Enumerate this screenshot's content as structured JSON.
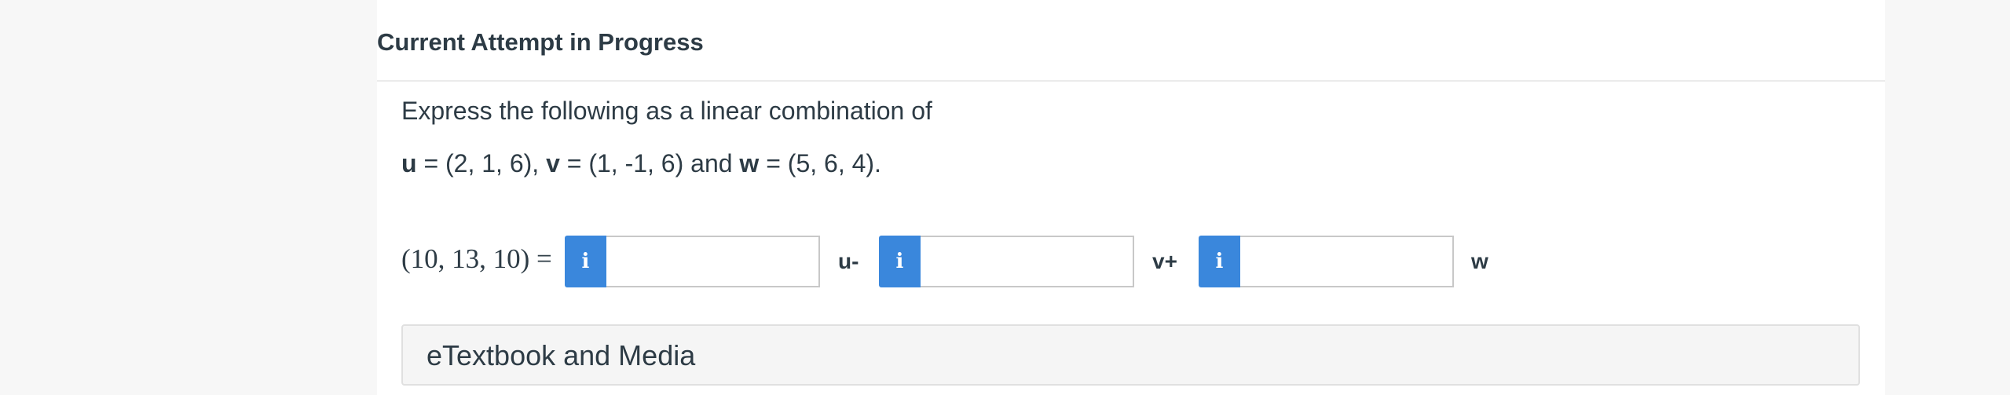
{
  "header": {
    "title": "Current Attempt in Progress"
  },
  "question": {
    "line1": "Express the following as a linear combination of",
    "vectors": {
      "u_name": "u",
      "u_value": " = (2, 1, 6), ",
      "v_name": "v",
      "v_value": " = (1, -1, 6) and ",
      "w_name": "w",
      "w_value": " = (5, 6, 4)."
    },
    "lhs": "(10, 13, 10) =",
    "answers": [
      {
        "info_icon": "i",
        "value": "",
        "placeholder": "",
        "suffix": "u-"
      },
      {
        "info_icon": "i",
        "value": "",
        "placeholder": "",
        "suffix": "v+"
      },
      {
        "info_icon": "i",
        "value": "",
        "placeholder": "",
        "suffix": "w"
      }
    ]
  },
  "etextbook": {
    "label": "eTextbook and Media"
  },
  "colors": {
    "accent": "#3a87dc",
    "text": "#2d3b45",
    "background": "#f7f7f7",
    "panel": "#ffffff"
  }
}
